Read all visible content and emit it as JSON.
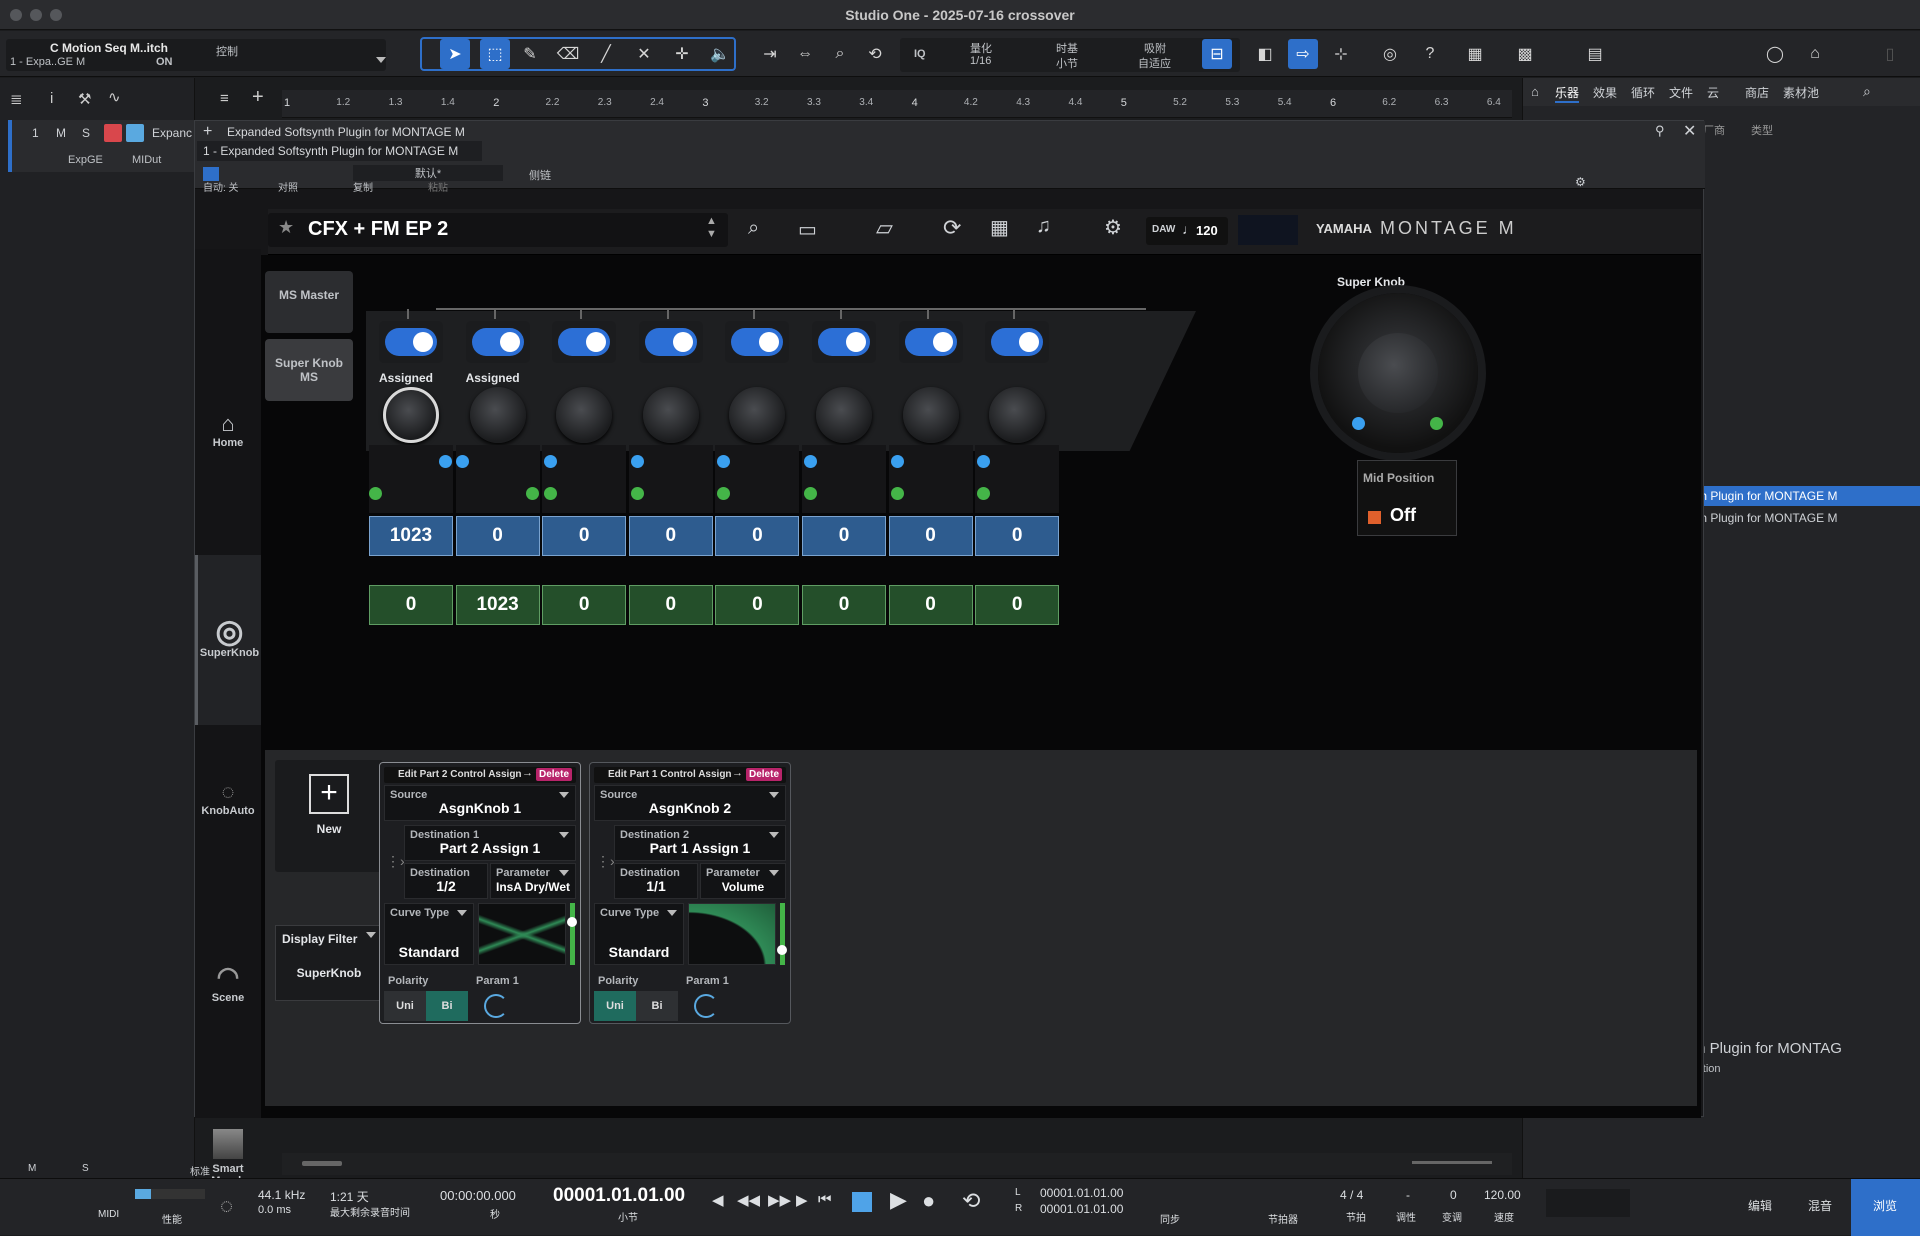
{
  "window": {
    "title": "Studio One - 2025-07-16 crossover"
  },
  "track_header": {
    "name": "C Motion Seq M..itch",
    "sub": "1 - Expa..GE M",
    "on": "ON",
    "ctrl": "控制"
  },
  "toolbar": {
    "iq": "IQ",
    "quant_label": "量化",
    "quant_val": "1/16",
    "timebase_label": "时基",
    "timebase_val": "小节",
    "snap_label": "吸附",
    "snap_val": "自适应"
  },
  "ruler": {
    "ticks": [
      "1",
      "1.2",
      "1.3",
      "1.4",
      "2",
      "2.2",
      "2.3",
      "2.4",
      "3",
      "3.2",
      "3.3",
      "3.4",
      "4",
      "4.2",
      "4.3",
      "4.4",
      "5",
      "5.2",
      "5.3",
      "5.4",
      "6",
      "6.2",
      "6.3",
      "6.4"
    ]
  },
  "track": {
    "num": "1",
    "m": "M",
    "s": "S",
    "name": "Expanc",
    "in": "ExpGE",
    "out": "MIDut"
  },
  "browser_tabs": [
    "乐器",
    "效果",
    "循环",
    "文件",
    "云",
    "商店",
    "素材池"
  ],
  "browser": {
    "col_a": "厂商",
    "col_b": "类型",
    "item1": "th Plugin for MONTAGE M",
    "item2": "th Plugin for MONTAGE M",
    "footer1": "th Plugin for MONTAG",
    "footer2": "ration"
  },
  "plugin": {
    "tab_title": "Expanded Softsynth Plugin for MONTAGE M",
    "instance": "1 - Expanded Softsynth Plugin for MONTAGE M",
    "preset": "默认*",
    "auto": "自动: 关",
    "compare": "对照",
    "copy": "复制",
    "paste": "粘贴",
    "sidechain": "侧链"
  },
  "montage": {
    "perf_name": "CFX + FM EP 2",
    "daw": "DAW",
    "tempo": "120",
    "brand1": "YAMAHA",
    "brand2": "MONTAGE M",
    "side": [
      {
        "label": "Home",
        "icon": "home-icon"
      },
      {
        "label": "SuperKnob",
        "icon": "superknob-icon"
      },
      {
        "label": "KnobAuto",
        "icon": "knobauto-icon"
      },
      {
        "label": "Scene",
        "icon": "scene-icon"
      },
      {
        "label": "Smart Morph",
        "icon": "smart-morph-icon"
      }
    ],
    "ms_master": "MS Master",
    "sk_ms": "Super Knob MS",
    "assigned": [
      "Assigned",
      "Assigned",
      "",
      "",
      "",
      "",
      "",
      ""
    ],
    "blue_vals": [
      "1023",
      "0",
      "0",
      "0",
      "0",
      "0",
      "0",
      "0"
    ],
    "green_vals": [
      "0",
      "1023",
      "0",
      "0",
      "0",
      "0",
      "0",
      "0"
    ],
    "super_knob_label": "Super Knob",
    "mid_position": "Mid Position",
    "mid_value": "Off",
    "new_label": "New",
    "display_filter": "Display Filter",
    "filter_value": "SuperKnob",
    "cards": [
      {
        "title": "Edit Part 2 Control Assign",
        "delete": "Delete",
        "source_label": "Source",
        "source": "AsgnKnob 1",
        "dest_label": "Destination 1",
        "dest": "Part 2 Assign 1",
        "dest_sub_label": "Destination",
        "dest_sub": "1/2",
        "param_label": "Parameter",
        "param": "InsA Dry/Wet",
        "curve_label": "Curve Type",
        "curve": "Standard",
        "polarity": "Polarity",
        "param1": "Param 1",
        "uni": "Uni",
        "bi": "Bi"
      },
      {
        "title": "Edit Part 1 Control Assign",
        "delete": "Delete",
        "source_label": "Source",
        "source": "AsgnKnob 2",
        "dest_label": "Destination 2",
        "dest": "Part 1 Assign 1",
        "dest_sub_label": "Destination",
        "dest_sub": "1/1",
        "param_label": "Parameter",
        "param": "Volume",
        "curve_label": "Curve Type",
        "curve": "Standard",
        "polarity": "Polarity",
        "param1": "Param 1",
        "uni": "Uni",
        "bi": "Bi"
      }
    ]
  },
  "statusbar": {
    "m": "M",
    "s": "S",
    "std": "标准"
  },
  "transport": {
    "midi": "MIDI",
    "perf": "性能",
    "sr": "44.1 kHz",
    "lat": "0.0 ms",
    "rec_time": "1:21 天",
    "rec_label": "最大剩余录音时间",
    "time": "00:00:00.000",
    "sec": "秒",
    "bars": "00001.01.01.00",
    "bar_label": "小节",
    "loop_l": "00001.01.01.00",
    "loop_r": "00001.01.01.00",
    "sync": "同步",
    "metro": "节拍器",
    "sig": "4 / 4",
    "sig_label": "节拍",
    "key": "-",
    "key_label": "调性",
    "transpose": "0",
    "transpose_label": "变调",
    "tempo": "120.00",
    "tempo_label": "速度",
    "edit": "编辑",
    "mix": "混音",
    "browse": "浏览",
    "L": "L",
    "R": "R"
  },
  "colors": {
    "accent": "#2e6fc9",
    "blue_val": "#2e5c8f",
    "green_val": "#244f2a",
    "delete": "#b8246a"
  }
}
